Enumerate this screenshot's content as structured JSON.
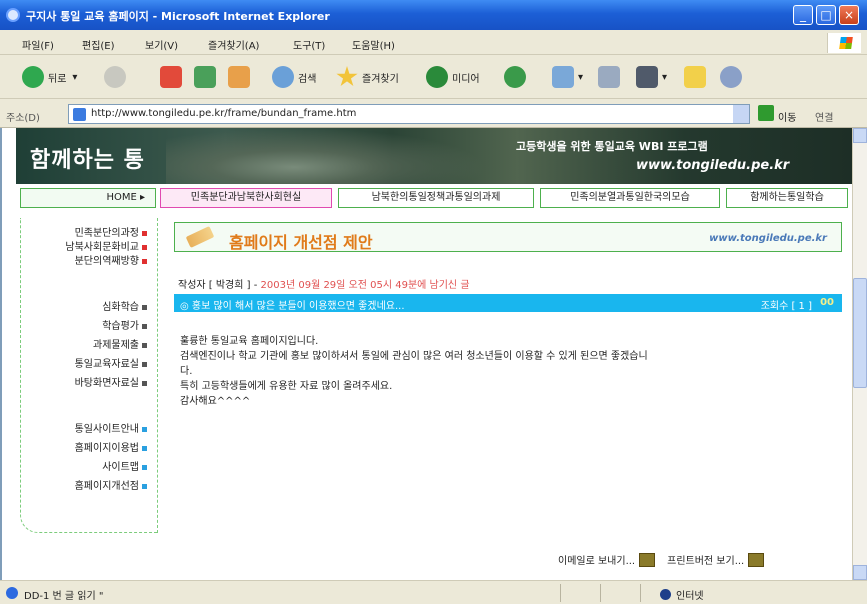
{
  "window": {
    "title": "구지사 통일 교육 홈페이지 - Microsoft Internet Explorer",
    "controls": [
      "_",
      "□",
      "×"
    ]
  },
  "menu": [
    "파일(F)",
    "편집(E)",
    "보기(V)",
    "즐겨찾기(A)",
    "도구(T)",
    "도움말(H)"
  ],
  "toolbar": {
    "back": "뒤로",
    "search": "검색",
    "favorites": "즐겨찾기",
    "media": "미디어"
  },
  "address": {
    "label": "주소(D)",
    "url": "http://www.tongiledu.pe.kr/frame/bundan_frame.htm",
    "go": "이동",
    "links": "연결"
  },
  "site": {
    "brand": "함께하는 통",
    "tagline": "고등학생을 위한 통일교육 WBI 프로그램",
    "url": "www.tongiledu.pe.kr"
  },
  "topnav": {
    "home": "HOME ▸",
    "tabs": [
      "민족분단과남북한사회현실",
      "남북한의통일정책과통일의과제",
      "민족의분열과통일한국의모습",
      "함께하는통일학습"
    ]
  },
  "sidebar": {
    "group1": [
      "민족분단의과정",
      "남북사회문화비교",
      "분단의역째방향"
    ],
    "group2": [
      "심화학습",
      "학습평가",
      "과제물제출",
      "통일교육자료실",
      "바탕화면자료실"
    ],
    "group3": [
      "통일사이트안내",
      "홈페이지이용법",
      "사이트맵",
      "홈페이지개선점"
    ]
  },
  "page": {
    "title": "홈페이지 개선점 제안",
    "url": "www.tongiledu.pe.kr",
    "author_label": "작성자 [ 박경희 ] -",
    "date": "2003년 09월 29일 오전 05시 49분에 남기신 글",
    "subject": "◎ 홍보 많이 해서 많은 분들이 이용했으면 좋겠네요...",
    "hits_label": "조회수 [ 1 ]",
    "hits_value": "00",
    "body": [
      "훌륭한 통일교육 홈페이지입니다.",
      "검색엔진이나 학교 기관에 홍보 많이하셔서 통일에 관심이 많은 여러 청소년들이 이용할 수 있게 된으면 좋겠습니",
      "다.",
      "특히 고등학생들에게 유용한 자료 많이 올려주세요.",
      "감사해요^^^^"
    ],
    "links": {
      "email": "이메일로 보내기...",
      "print": "프린트버전 보기..."
    }
  },
  "status": {
    "text": "DD-1 번 글 읽기 \"",
    "zone": "인터넷"
  },
  "colors": {
    "titlebar": "#1c5fd6",
    "subject_bar": "#19b6ee",
    "page_title": "#e07b1a",
    "nav_border": "#4db04d",
    "date": "#e05050"
  }
}
